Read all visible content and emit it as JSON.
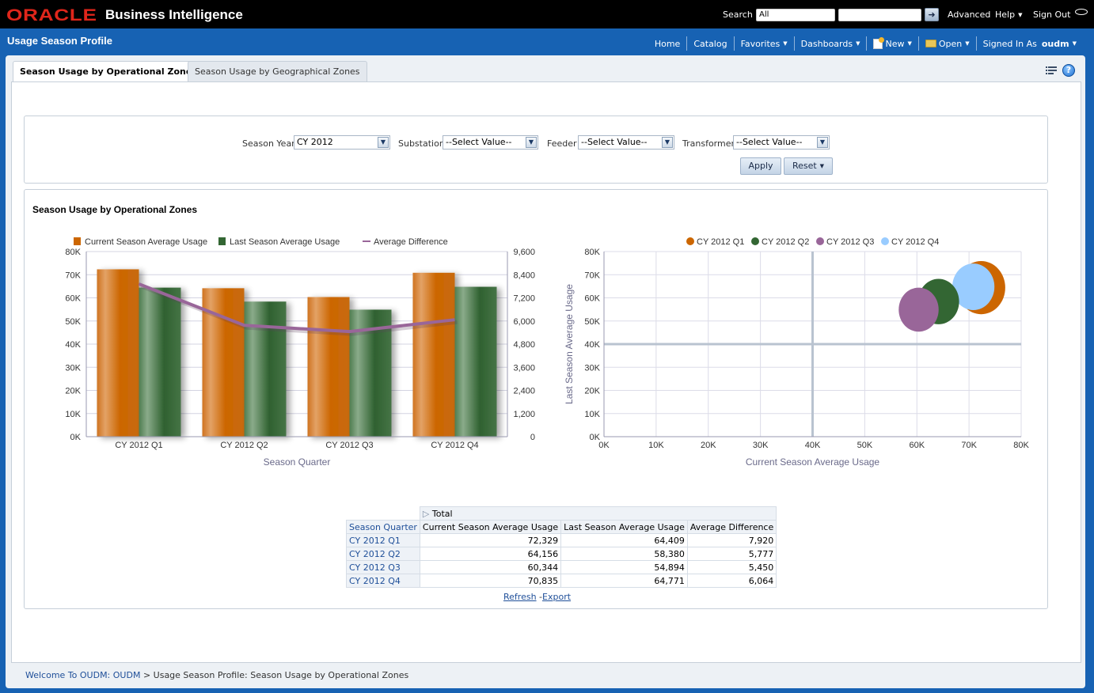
{
  "header": {
    "brand": "ORACLE",
    "product": "Business Intelligence",
    "search_label": "Search",
    "search_scope": "All",
    "search_value": "",
    "advanced": "Advanced",
    "help": "Help",
    "sign_out": "Sign Out"
  },
  "nav": {
    "page_title": "Usage Season Profile",
    "home": "Home",
    "catalog": "Catalog",
    "favorites": "Favorites",
    "dashboards": "Dashboards",
    "new": "New",
    "open": "Open",
    "signed_in_as": "Signed In As",
    "user": "oudm"
  },
  "tabs": [
    {
      "label": "Season Usage by Operational Zones",
      "active": true
    },
    {
      "label": "Season Usage by Geographical Zones",
      "active": false
    }
  ],
  "prompts": {
    "season_year": {
      "label": "Season Year",
      "value": "CY 2012"
    },
    "substation": {
      "label": "Substation",
      "value": "--Select Value--"
    },
    "feeder": {
      "label": "Feeder",
      "value": "--Select Value--"
    },
    "transformer": {
      "label": "Transformer",
      "value": "--Select Value--"
    },
    "apply": "Apply",
    "reset": "Reset"
  },
  "report": {
    "title": "Season Usage by Operational Zones"
  },
  "chart_data": [
    {
      "type": "bar",
      "title": "",
      "categories": [
        "CY 2012 Q1",
        "CY 2012 Q2",
        "CY 2012 Q3",
        "CY 2012 Q4"
      ],
      "series": [
        {
          "name": "Current Season Average Usage",
          "kind": "bar",
          "axis": "left",
          "color": "#cc6600",
          "values": [
            72329,
            64156,
            60344,
            70835
          ]
        },
        {
          "name": "Last Season Average Usage",
          "kind": "bar",
          "axis": "left",
          "color": "#336633",
          "values": [
            64409,
            58380,
            54894,
            64771
          ]
        },
        {
          "name": "Average Difference",
          "kind": "line",
          "axis": "right",
          "color": "#996699",
          "values": [
            7920,
            5777,
            5450,
            6064
          ]
        }
      ],
      "xlabel": "Season Quarter",
      "ylabel": "",
      "ylim": [
        0,
        80000
      ],
      "yticks": [
        "0K",
        "10K",
        "20K",
        "30K",
        "40K",
        "50K",
        "60K",
        "70K",
        "80K"
      ],
      "y2lim": [
        0,
        9600
      ],
      "y2ticks": [
        "0",
        "1,200",
        "2,400",
        "3,600",
        "4,800",
        "6,000",
        "7,200",
        "8,400",
        "9,600"
      ],
      "legend": "top",
      "grid": true
    },
    {
      "type": "scatter",
      "subtype": "bubble",
      "title": "",
      "xlabel": "Current Season Average Usage",
      "ylabel": "Last Season Average Usage",
      "xlim": [
        0,
        80000
      ],
      "ylim": [
        0,
        80000
      ],
      "xticks": [
        "0K",
        "10K",
        "20K",
        "30K",
        "40K",
        "50K",
        "60K",
        "70K",
        "80K"
      ],
      "yticks": [
        "0K",
        "10K",
        "20K",
        "30K",
        "40K",
        "50K",
        "60K",
        "70K",
        "80K"
      ],
      "quadrant_lines": {
        "x": 40000,
        "y": 40000
      },
      "legend": "top",
      "grid": true,
      "series": [
        {
          "name": "CY 2012 Q1",
          "color": "#cc6600",
          "x": 72329,
          "y": 64409,
          "size": 7920
        },
        {
          "name": "CY 2012 Q2",
          "color": "#336633",
          "x": 64156,
          "y": 58380,
          "size": 5777
        },
        {
          "name": "CY 2012 Q3",
          "color": "#996699",
          "x": 60344,
          "y": 54894,
          "size": 5450
        },
        {
          "name": "CY 2012 Q4",
          "color": "#99ccff",
          "x": 70835,
          "y": 64771,
          "size": 6064
        }
      ]
    }
  ],
  "table": {
    "group_header": "Total",
    "row_header": "Season Quarter",
    "columns": [
      "Current Season Average Usage",
      "Last Season Average Usage",
      "Average Difference"
    ],
    "rows": [
      {
        "label": "CY 2012 Q1",
        "values": [
          "72,329",
          "64,409",
          "7,920"
        ]
      },
      {
        "label": "CY 2012 Q2",
        "values": [
          "64,156",
          "58,380",
          "5,777"
        ]
      },
      {
        "label": "CY 2012 Q3",
        "values": [
          "60,344",
          "54,894",
          "5,450"
        ]
      },
      {
        "label": "CY 2012 Q4",
        "values": [
          "70,835",
          "64,771",
          "6,064"
        ]
      }
    ],
    "refresh": "Refresh",
    "export": "Export"
  },
  "breadcrumb": {
    "root": "Welcome To OUDM: OUDM",
    "separator": ">",
    "current": "Usage Season Profile: Season Usage by Operational Zones"
  }
}
